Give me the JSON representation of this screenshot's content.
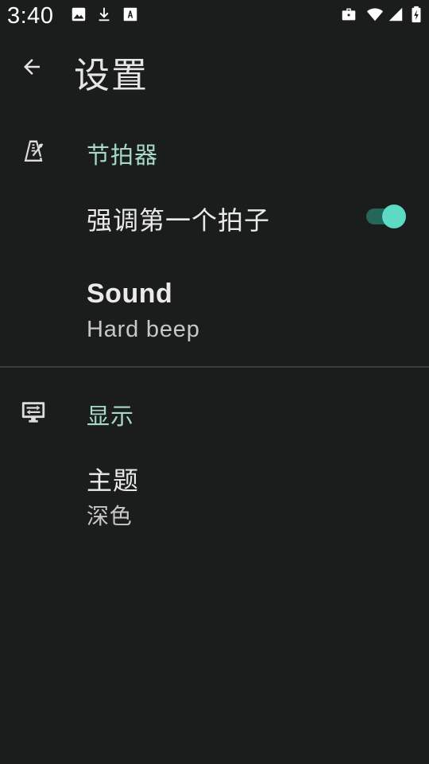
{
  "status_bar": {
    "time": "3:40"
  },
  "app_bar": {
    "title": "设置",
    "back_icon": "arrow-back-icon"
  },
  "categories": [
    {
      "title": "节拍器",
      "icon": "metronome-icon",
      "items": [
        {
          "title": "强调第一个拍子",
          "switch_on": true
        },
        {
          "title": "Sound",
          "summary": "Hard beep"
        }
      ]
    },
    {
      "title": "显示",
      "icon": "display-icon",
      "items": [
        {
          "title": "主题",
          "summary": "深色"
        }
      ]
    }
  ],
  "colors": {
    "background": "#1b1c1c",
    "category_accent": "#a7d8c8",
    "switch_thumb": "#5dd9c4",
    "switch_track": "#24665a"
  }
}
